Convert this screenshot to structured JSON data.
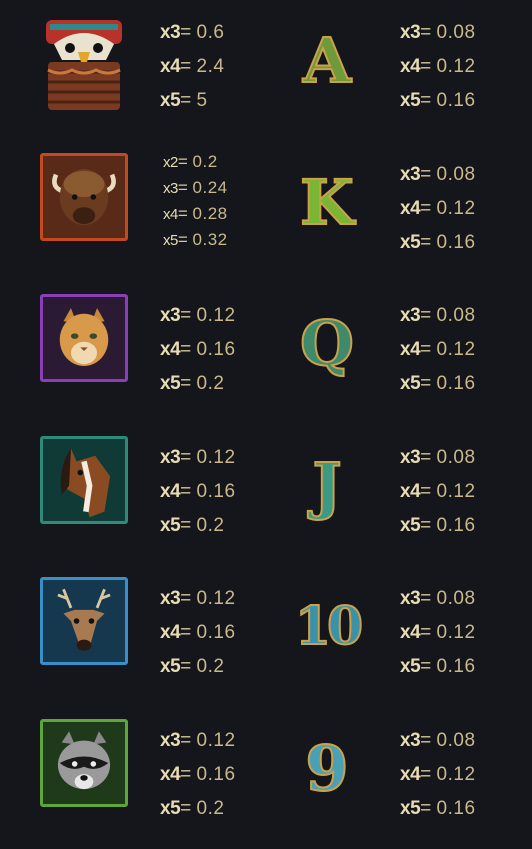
{
  "paytable": {
    "rows": [
      {
        "symbol": {
          "name": "totem-eagle",
          "icon": "totem-icon",
          "frame": "",
          "bg": "#7a2a1e"
        },
        "pays": [
          {
            "mult": "x3",
            "eq": "=",
            "value": "0.6"
          },
          {
            "mult": "x4",
            "eq": "=",
            "value": "2.4"
          },
          {
            "mult": "x5",
            "eq": "=",
            "value": "5"
          }
        ],
        "card": {
          "label": "A",
          "color": "#6f9a3a"
        },
        "card_pays": [
          {
            "mult": "x3",
            "eq": "=",
            "value": "0.08"
          },
          {
            "mult": "x4",
            "eq": "=",
            "value": "0.12"
          },
          {
            "mult": "x5",
            "eq": "=",
            "value": "0.16"
          }
        ]
      },
      {
        "symbol": {
          "name": "bison",
          "icon": "bison-icon",
          "frame": "#c24a1e",
          "bg": "#5a2a18"
        },
        "pays": [
          {
            "mult": "x2",
            "eq": "=",
            "value": "0.2"
          },
          {
            "mult": "x3",
            "eq": "=",
            "value": "0.24"
          },
          {
            "mult": "x4",
            "eq": "=",
            "value": "0.28"
          },
          {
            "mult": "x5",
            "eq": "=",
            "value": "0.32"
          }
        ],
        "card": {
          "label": "K",
          "color": "#7ab534"
        },
        "card_pays": [
          {
            "mult": "x3",
            "eq": "=",
            "value": "0.08"
          },
          {
            "mult": "x4",
            "eq": "=",
            "value": "0.12"
          },
          {
            "mult": "x5",
            "eq": "=",
            "value": "0.16"
          }
        ]
      },
      {
        "symbol": {
          "name": "cougar",
          "icon": "cougar-icon",
          "frame": "#8a3fb8",
          "bg": "#2a1a33"
        },
        "pays": [
          {
            "mult": "x3",
            "eq": "=",
            "value": "0.12"
          },
          {
            "mult": "x4",
            "eq": "=",
            "value": "0.16"
          },
          {
            "mult": "x5",
            "eq": "=",
            "value": "0.2"
          }
        ],
        "card": {
          "label": "Q",
          "color": "#3f8a6a"
        },
        "card_pays": [
          {
            "mult": "x3",
            "eq": "=",
            "value": "0.08"
          },
          {
            "mult": "x4",
            "eq": "=",
            "value": "0.12"
          },
          {
            "mult": "x5",
            "eq": "=",
            "value": "0.16"
          }
        ]
      },
      {
        "symbol": {
          "name": "horse",
          "icon": "horse-icon",
          "frame": "#2f8a7a",
          "bg": "#103a36"
        },
        "pays": [
          {
            "mult": "x3",
            "eq": "=",
            "value": "0.12"
          },
          {
            "mult": "x4",
            "eq": "=",
            "value": "0.16"
          },
          {
            "mult": "x5",
            "eq": "=",
            "value": "0.2"
          }
        ],
        "card": {
          "label": "J",
          "color": "#3a9a86"
        },
        "card_pays": [
          {
            "mult": "x3",
            "eq": "=",
            "value": "0.08"
          },
          {
            "mult": "x4",
            "eq": "=",
            "value": "0.12"
          },
          {
            "mult": "x5",
            "eq": "=",
            "value": "0.16"
          }
        ]
      },
      {
        "symbol": {
          "name": "deer",
          "icon": "deer-icon",
          "frame": "#3a8fc8",
          "bg": "#16384e"
        },
        "pays": [
          {
            "mult": "x3",
            "eq": "=",
            "value": "0.12"
          },
          {
            "mult": "x4",
            "eq": "=",
            "value": "0.16"
          },
          {
            "mult": "x5",
            "eq": "=",
            "value": "0.2"
          }
        ],
        "card": {
          "label": "10",
          "color": "#3b92a8"
        },
        "card_pays": [
          {
            "mult": "x3",
            "eq": "=",
            "value": "0.08"
          },
          {
            "mult": "x4",
            "eq": "=",
            "value": "0.12"
          },
          {
            "mult": "x5",
            "eq": "=",
            "value": "0.16"
          }
        ]
      },
      {
        "symbol": {
          "name": "raccoon",
          "icon": "raccoon-icon",
          "frame": "#5fa63a",
          "bg": "#1f3a1a"
        },
        "pays": [
          {
            "mult": "x3",
            "eq": "=",
            "value": "0.12"
          },
          {
            "mult": "x4",
            "eq": "=",
            "value": "0.16"
          },
          {
            "mult": "x5",
            "eq": "=",
            "value": "0.2"
          }
        ],
        "card": {
          "label": "9",
          "color": "#4aa0b4"
        },
        "card_pays": [
          {
            "mult": "x3",
            "eq": "=",
            "value": "0.08"
          },
          {
            "mult": "x4",
            "eq": "=",
            "value": "0.12"
          },
          {
            "mult": "x5",
            "eq": "=",
            "value": "0.16"
          }
        ]
      }
    ]
  }
}
